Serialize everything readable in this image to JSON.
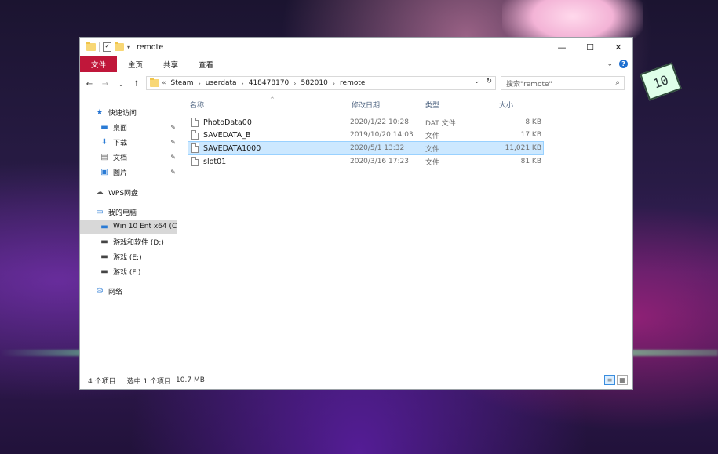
{
  "window": {
    "title": "remote",
    "controls": {
      "minimize": "—",
      "maximize": "☐",
      "close": "✕"
    }
  },
  "ribbon": {
    "tabs": [
      "文件",
      "主页",
      "共享",
      "查看"
    ],
    "help_label": "?",
    "expand_label": "⌄"
  },
  "address": {
    "lead": "«",
    "crumbs": [
      "Steam",
      "userdata",
      "418478170",
      "582010",
      "remote"
    ],
    "separator": "›",
    "search_placeholder": "搜索\"remote\""
  },
  "nav": {
    "quick_access": "快速访问",
    "desktop": "桌面",
    "downloads": "下载",
    "documents": "文档",
    "pictures": "图片",
    "wps": "WPS网盘",
    "this_pc": "我的电脑",
    "drive_c": "Win 10 Ent x64 (C",
    "drive_d": "游戏和软件 (D:)",
    "drive_e": "游戏 (E:)",
    "drive_f": "游戏 (F:)",
    "network": "网络"
  },
  "columns": {
    "name": "名称",
    "date": "修改日期",
    "type": "类型",
    "size": "大小"
  },
  "files": [
    {
      "name": "PhotoData00",
      "date": "2020/1/22 10:28",
      "type": "DAT 文件",
      "size": "8 KB"
    },
    {
      "name": "SAVEDATA_B",
      "date": "2019/10/20 14:03",
      "type": "文件",
      "size": "17 KB"
    },
    {
      "name": "SAVEDATA1000",
      "date": "2020/5/1 13:32",
      "type": "文件",
      "size": "11,021 KB"
    },
    {
      "name": "slot01",
      "date": "2020/3/16 17:23",
      "type": "文件",
      "size": "81 KB"
    }
  ],
  "status": {
    "count": "4 个项目",
    "selected": "选中 1 个项目",
    "size": "10.7 MB"
  },
  "background": {
    "badge": "10"
  }
}
